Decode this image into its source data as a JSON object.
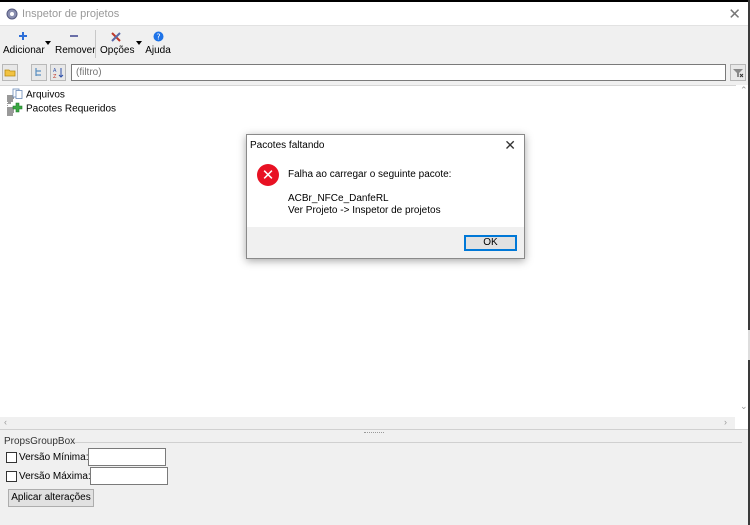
{
  "window": {
    "title": "Inspetor de projetos",
    "close_icon": "close-icon"
  },
  "toolbar": {
    "add_label": "Adicionar",
    "remove_label": "Remover",
    "options_label": "Opções",
    "help_label": "Ajuda"
  },
  "filter": {
    "placeholder": "(filtro)"
  },
  "tree": {
    "items": [
      {
        "label": "Arquivos",
        "icon": "files-icon"
      },
      {
        "label": "Pacotes Requeridos",
        "icon": "package-icon"
      }
    ]
  },
  "props": {
    "group_title": "PropsGroupBox",
    "min_version_label": "Versão Mínima:",
    "max_version_label": "Versão Máxima:",
    "min_version_value": "",
    "max_version_value": "",
    "apply_label": "Aplicar alterações"
  },
  "dialog": {
    "title": "Pacotes faltando",
    "message": "Falha ao carregar o seguinte pacote:",
    "package": "ACBr_NFCe_DanfeRL",
    "hint": "Ver Projeto -> Inspetor de projetos",
    "ok_label": "OK"
  },
  "colors": {
    "error": "#e81123",
    "accent": "#0078d7",
    "help_blue": "#1e73e8",
    "package_green": "#3aa842"
  }
}
